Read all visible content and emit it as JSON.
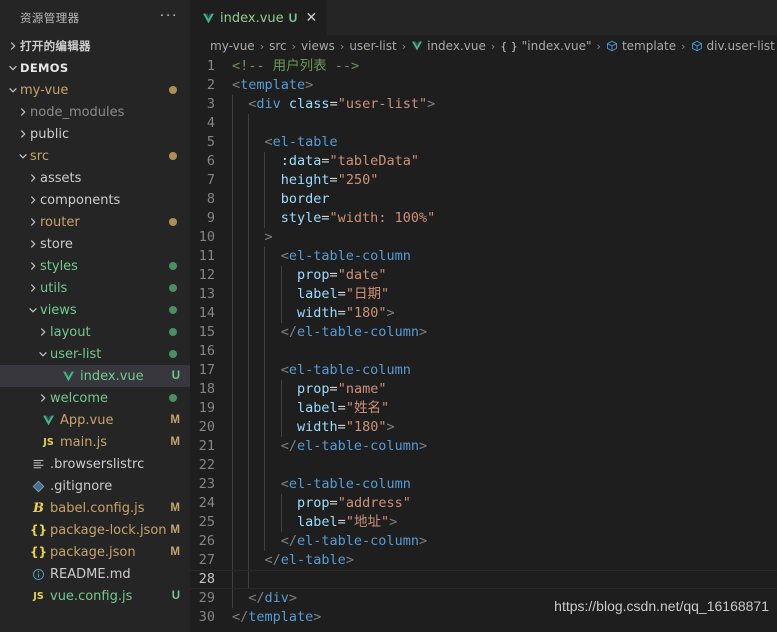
{
  "sidebar": {
    "title": "资源管理器",
    "more_label": "···",
    "open_editors_label": "打开的编辑器",
    "root_label": "DEMOS",
    "items": [
      {
        "label": "my-vue",
        "indent": 1,
        "kind": "folder",
        "expanded": true,
        "color": "#c8a46a",
        "dot": "#b08d57",
        "badge": ""
      },
      {
        "label": "node_modules",
        "indent": 2,
        "kind": "folder",
        "expanded": false,
        "color": "#8b8b8b",
        "dot": "",
        "badge": ""
      },
      {
        "label": "public",
        "indent": 2,
        "kind": "folder",
        "expanded": false,
        "color": "#cccccc",
        "dot": "",
        "badge": ""
      },
      {
        "label": "src",
        "indent": 2,
        "kind": "folder",
        "expanded": true,
        "color": "#c8a46a",
        "dot": "#b08d57",
        "badge": ""
      },
      {
        "label": "assets",
        "indent": 3,
        "kind": "folder",
        "expanded": false,
        "color": "#cccccc",
        "dot": "",
        "badge": ""
      },
      {
        "label": "components",
        "indent": 3,
        "kind": "folder",
        "expanded": false,
        "color": "#cccccc",
        "dot": "",
        "badge": ""
      },
      {
        "label": "router",
        "indent": 3,
        "kind": "folder",
        "expanded": false,
        "color": "#c8a46a",
        "dot": "#b08d57",
        "badge": ""
      },
      {
        "label": "store",
        "indent": 3,
        "kind": "folder",
        "expanded": false,
        "color": "#cccccc",
        "dot": "",
        "badge": ""
      },
      {
        "label": "styles",
        "indent": 3,
        "kind": "folder",
        "expanded": false,
        "color": "#73c991",
        "dot": "#4a8f62",
        "badge": ""
      },
      {
        "label": "utils",
        "indent": 3,
        "kind": "folder",
        "expanded": false,
        "color": "#73c991",
        "dot": "#4a8f62",
        "badge": ""
      },
      {
        "label": "views",
        "indent": 3,
        "kind": "folder",
        "expanded": true,
        "color": "#73c991",
        "dot": "#4a8f62",
        "badge": ""
      },
      {
        "label": "layout",
        "indent": 4,
        "kind": "folder",
        "expanded": false,
        "color": "#73c991",
        "dot": "#4a8f62",
        "badge": ""
      },
      {
        "label": "user-list",
        "indent": 4,
        "kind": "folder",
        "expanded": true,
        "color": "#73c991",
        "dot": "#4a8f62",
        "badge": ""
      },
      {
        "label": "index.vue",
        "indent": 5,
        "kind": "vue",
        "expanded": null,
        "color": "#73c991",
        "dot": "",
        "badge": "U",
        "badge_color": "#73c991",
        "selected": true
      },
      {
        "label": "welcome",
        "indent": 4,
        "kind": "folder",
        "expanded": false,
        "color": "#73c991",
        "dot": "#4a8f62",
        "badge": ""
      },
      {
        "label": "App.vue",
        "indent": 3,
        "kind": "vue",
        "expanded": null,
        "color": "#c8a46a",
        "dot": "",
        "badge": "M",
        "badge_color": "#c8a46a"
      },
      {
        "label": "main.js",
        "indent": 3,
        "kind": "js",
        "expanded": null,
        "color": "#c8a46a",
        "dot": "",
        "badge": "M",
        "badge_color": "#c8a46a"
      },
      {
        "label": ".browserslistrc",
        "indent": 2,
        "kind": "text",
        "expanded": null,
        "color": "#cccccc",
        "dot": "",
        "badge": ""
      },
      {
        "label": ".gitignore",
        "indent": 2,
        "kind": "git",
        "expanded": null,
        "color": "#cccccc",
        "dot": "",
        "badge": ""
      },
      {
        "label": "babel.config.js",
        "indent": 2,
        "kind": "babel",
        "expanded": null,
        "color": "#c8a46a",
        "dot": "",
        "badge": "M",
        "badge_color": "#c8a46a"
      },
      {
        "label": "package-lock.json",
        "indent": 2,
        "kind": "json",
        "expanded": null,
        "color": "#c8a46a",
        "dot": "",
        "badge": "M",
        "badge_color": "#c8a46a"
      },
      {
        "label": "package.json",
        "indent": 2,
        "kind": "json",
        "expanded": null,
        "color": "#c8a46a",
        "dot": "",
        "badge": "M",
        "badge_color": "#c8a46a"
      },
      {
        "label": "README.md",
        "indent": 2,
        "kind": "info",
        "expanded": null,
        "color": "#cccccc",
        "dot": "",
        "badge": ""
      },
      {
        "label": "vue.config.js",
        "indent": 2,
        "kind": "js",
        "expanded": null,
        "color": "#73c991",
        "dot": "",
        "badge": "U",
        "badge_color": "#73c991"
      }
    ]
  },
  "editor": {
    "tab": {
      "name": "index.vue",
      "badge": "U",
      "close": "✕"
    },
    "breadcrumb": [
      {
        "text": "my-vue",
        "icon": ""
      },
      {
        "text": "src",
        "icon": ""
      },
      {
        "text": "views",
        "icon": ""
      },
      {
        "text": "user-list",
        "icon": ""
      },
      {
        "text": "index.vue",
        "icon": "vue"
      },
      {
        "text": "\"index.vue\"",
        "icon": "braces"
      },
      {
        "text": "template",
        "icon": "cube"
      },
      {
        "text": "div.user-list",
        "icon": "cube"
      }
    ],
    "current_line": 28,
    "lines": [
      {
        "n": 1,
        "indent": 0,
        "tokens": [
          {
            "c": "t-comment",
            "t": "<!-- 用户列表 -->"
          }
        ]
      },
      {
        "n": 2,
        "indent": 0,
        "tokens": [
          {
            "c": "t-punc",
            "t": "<"
          },
          {
            "c": "t-tag",
            "t": "template"
          },
          {
            "c": "t-punc",
            "t": ">"
          }
        ]
      },
      {
        "n": 3,
        "indent": 1,
        "tokens": [
          {
            "c": "t-punc",
            "t": "  <"
          },
          {
            "c": "t-tag",
            "t": "div"
          },
          {
            "c": "t-eq",
            "t": " "
          },
          {
            "c": "t-attr",
            "t": "class"
          },
          {
            "c": "t-eq",
            "t": "="
          },
          {
            "c": "t-str",
            "t": "\"user-list\""
          },
          {
            "c": "t-punc",
            "t": ">"
          }
        ]
      },
      {
        "n": 4,
        "indent": 2,
        "tokens": [
          {
            "c": "t-eq",
            "t": ""
          }
        ]
      },
      {
        "n": 5,
        "indent": 2,
        "tokens": [
          {
            "c": "t-punc",
            "t": "    <"
          },
          {
            "c": "t-tag",
            "t": "el-table"
          }
        ]
      },
      {
        "n": 6,
        "indent": 3,
        "tokens": [
          {
            "c": "t-attr",
            "t": "      :data"
          },
          {
            "c": "t-eq",
            "t": "="
          },
          {
            "c": "t-str",
            "t": "\"tableData\""
          }
        ]
      },
      {
        "n": 7,
        "indent": 3,
        "tokens": [
          {
            "c": "t-attr",
            "t": "      height"
          },
          {
            "c": "t-eq",
            "t": "="
          },
          {
            "c": "t-str",
            "t": "\"250\""
          }
        ]
      },
      {
        "n": 8,
        "indent": 3,
        "tokens": [
          {
            "c": "t-attr",
            "t": "      border"
          }
        ]
      },
      {
        "n": 9,
        "indent": 3,
        "tokens": [
          {
            "c": "t-attr",
            "t": "      style"
          },
          {
            "c": "t-eq",
            "t": "="
          },
          {
            "c": "t-str",
            "t": "\"width: 100%\""
          }
        ]
      },
      {
        "n": 10,
        "indent": 2,
        "tokens": [
          {
            "c": "t-punc",
            "t": "    >"
          }
        ]
      },
      {
        "n": 11,
        "indent": 3,
        "tokens": [
          {
            "c": "t-punc",
            "t": "      <"
          },
          {
            "c": "t-tag",
            "t": "el-table-column"
          }
        ]
      },
      {
        "n": 12,
        "indent": 4,
        "tokens": [
          {
            "c": "t-attr",
            "t": "        prop"
          },
          {
            "c": "t-eq",
            "t": "="
          },
          {
            "c": "t-str",
            "t": "\"date\""
          }
        ]
      },
      {
        "n": 13,
        "indent": 4,
        "tokens": [
          {
            "c": "t-attr",
            "t": "        label"
          },
          {
            "c": "t-eq",
            "t": "="
          },
          {
            "c": "t-str",
            "t": "\"日期\""
          }
        ]
      },
      {
        "n": 14,
        "indent": 4,
        "tokens": [
          {
            "c": "t-attr",
            "t": "        width"
          },
          {
            "c": "t-eq",
            "t": "="
          },
          {
            "c": "t-str",
            "t": "\"180\""
          },
          {
            "c": "t-punc",
            "t": ">"
          }
        ]
      },
      {
        "n": 15,
        "indent": 3,
        "tokens": [
          {
            "c": "t-punc",
            "t": "      </"
          },
          {
            "c": "t-tag",
            "t": "el-table-column"
          },
          {
            "c": "t-punc",
            "t": ">"
          }
        ]
      },
      {
        "n": 16,
        "indent": 3,
        "tokens": [
          {
            "c": "t-eq",
            "t": ""
          }
        ]
      },
      {
        "n": 17,
        "indent": 3,
        "tokens": [
          {
            "c": "t-punc",
            "t": "      <"
          },
          {
            "c": "t-tag",
            "t": "el-table-column"
          }
        ]
      },
      {
        "n": 18,
        "indent": 4,
        "tokens": [
          {
            "c": "t-attr",
            "t": "        prop"
          },
          {
            "c": "t-eq",
            "t": "="
          },
          {
            "c": "t-str",
            "t": "\"name\""
          }
        ]
      },
      {
        "n": 19,
        "indent": 4,
        "tokens": [
          {
            "c": "t-attr",
            "t": "        label"
          },
          {
            "c": "t-eq",
            "t": "="
          },
          {
            "c": "t-str",
            "t": "\"姓名\""
          }
        ]
      },
      {
        "n": 20,
        "indent": 4,
        "tokens": [
          {
            "c": "t-attr",
            "t": "        width"
          },
          {
            "c": "t-eq",
            "t": "="
          },
          {
            "c": "t-str",
            "t": "\"180\""
          },
          {
            "c": "t-punc",
            "t": ">"
          }
        ]
      },
      {
        "n": 21,
        "indent": 3,
        "tokens": [
          {
            "c": "t-punc",
            "t": "      </"
          },
          {
            "c": "t-tag",
            "t": "el-table-column"
          },
          {
            "c": "t-punc",
            "t": ">"
          }
        ]
      },
      {
        "n": 22,
        "indent": 3,
        "tokens": [
          {
            "c": "t-eq",
            "t": ""
          }
        ]
      },
      {
        "n": 23,
        "indent": 3,
        "tokens": [
          {
            "c": "t-punc",
            "t": "      <"
          },
          {
            "c": "t-tag",
            "t": "el-table-column"
          }
        ]
      },
      {
        "n": 24,
        "indent": 4,
        "tokens": [
          {
            "c": "t-attr",
            "t": "        prop"
          },
          {
            "c": "t-eq",
            "t": "="
          },
          {
            "c": "t-str",
            "t": "\"address\""
          }
        ]
      },
      {
        "n": 25,
        "indent": 4,
        "tokens": [
          {
            "c": "t-attr",
            "t": "        label"
          },
          {
            "c": "t-eq",
            "t": "="
          },
          {
            "c": "t-str",
            "t": "\"地址\""
          },
          {
            "c": "t-punc",
            "t": ">"
          }
        ]
      },
      {
        "n": 26,
        "indent": 3,
        "tokens": [
          {
            "c": "t-punc",
            "t": "      </"
          },
          {
            "c": "t-tag",
            "t": "el-table-column"
          },
          {
            "c": "t-punc",
            "t": ">"
          }
        ]
      },
      {
        "n": 27,
        "indent": 2,
        "tokens": [
          {
            "c": "t-punc",
            "t": "    </"
          },
          {
            "c": "t-tag",
            "t": "el-table"
          },
          {
            "c": "t-punc",
            "t": ">"
          }
        ]
      },
      {
        "n": 28,
        "indent": 2,
        "tokens": [
          {
            "c": "t-eq",
            "t": ""
          }
        ]
      },
      {
        "n": 29,
        "indent": 1,
        "tokens": [
          {
            "c": "t-punc",
            "t": "  </"
          },
          {
            "c": "t-tag",
            "t": "div"
          },
          {
            "c": "t-punc",
            "t": ">"
          }
        ]
      },
      {
        "n": 30,
        "indent": 0,
        "tokens": [
          {
            "c": "t-punc",
            "t": "</"
          },
          {
            "c": "t-tag",
            "t": "template"
          },
          {
            "c": "t-punc",
            "t": ">"
          }
        ]
      }
    ]
  },
  "watermark": "https://blog.csdn.net/qq_16168871",
  "colors": {
    "sidebar_bg": "#252526",
    "editor_bg": "#1e1e1e",
    "selected_row": "#37373d",
    "comment": "#6a9955",
    "tag": "#569cd6",
    "attr": "#9cdcfe",
    "string": "#ce9178",
    "vue_green": "#73c991",
    "modified_gold": "#c8a46a"
  }
}
